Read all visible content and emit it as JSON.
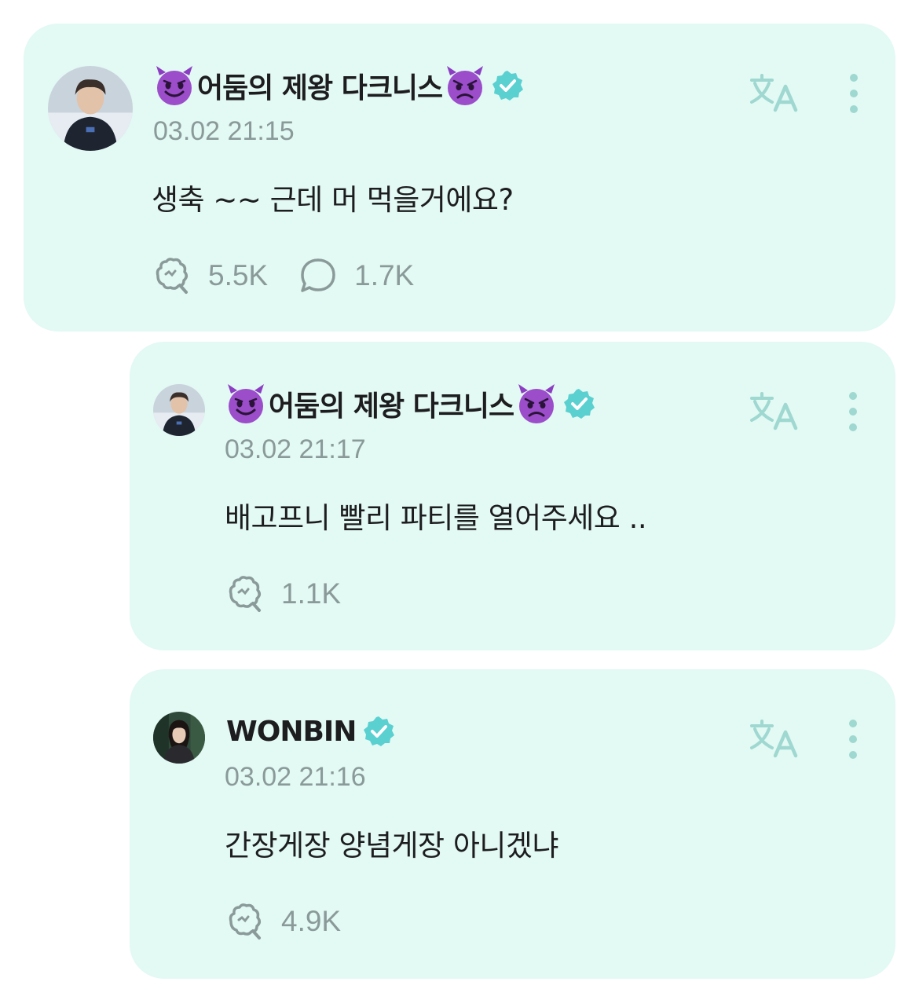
{
  "colors": {
    "card_background": "#e3f9f4",
    "muted_text": "#8a9a98",
    "verified_badge": "#5ad0d0",
    "primary_text": "#1d1d1f"
  },
  "comments": [
    {
      "author": "어둠의 제왕 다크니스",
      "author_prefix_emoji": "smiling-devil-emoji",
      "author_suffix_emoji": "angry-devil-emoji",
      "verified": true,
      "timestamp": "03.02 21:15",
      "text": "생축 ~~ 근데 머 먹을거에요?",
      "likes": "5.5K",
      "replies": "1.7K"
    },
    {
      "author": "어둠의 제왕 다크니스",
      "author_prefix_emoji": "smiling-devil-emoji",
      "author_suffix_emoji": "angry-devil-emoji",
      "verified": true,
      "timestamp": "03.02 21:17",
      "text": "배고프니 빨리 파티를 열어주세요 ..",
      "likes": "1.1K"
    },
    {
      "author": "WONBIN",
      "verified": true,
      "timestamp": "03.02 21:16",
      "text": "간장게장 양념게장 아니겠냐",
      "likes": "4.9K"
    }
  ],
  "icons": {
    "translate": "translate-icon",
    "more": "more-vertical-icon",
    "like": "like-icon",
    "reply": "comment-bubble-icon",
    "verified": "verified-badge-icon"
  }
}
